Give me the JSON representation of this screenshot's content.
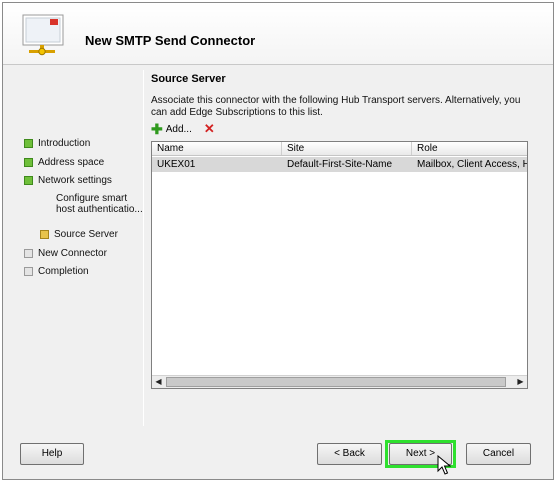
{
  "wizard": {
    "title": "New SMTP Send Connector"
  },
  "nav": {
    "items": [
      {
        "label": "Introduction",
        "state": "done"
      },
      {
        "label": "Address space",
        "state": "done"
      },
      {
        "label": "Network settings",
        "state": "done"
      },
      {
        "label": "Configure smart",
        "label2": "host authenticatio...",
        "state": "sub"
      },
      {
        "label": "Source Server",
        "state": "current"
      },
      {
        "label": "New Connector",
        "state": "todo"
      },
      {
        "label": "Completion",
        "state": "todo"
      }
    ]
  },
  "main": {
    "section_title": "Source Server",
    "description": "Associate this connector with the following Hub Transport servers. Alternatively, you can add Edge Subscriptions to this list.",
    "add_label": "Add...",
    "delete_glyph": "✕",
    "columns": [
      "Name",
      "Site",
      "Role"
    ],
    "rows": [
      {
        "name": "UKEX01",
        "site": "Default-First-Site-Name",
        "role": "Mailbox, Client Access, Hu"
      }
    ]
  },
  "buttons": {
    "help": "Help",
    "back": "< Back",
    "next": "Next >",
    "cancel": "Cancel"
  },
  "colors": {
    "done": "#6fbf3a",
    "current": "#e8c34a",
    "highlight": "#2ee02e",
    "delete": "#d32222"
  }
}
